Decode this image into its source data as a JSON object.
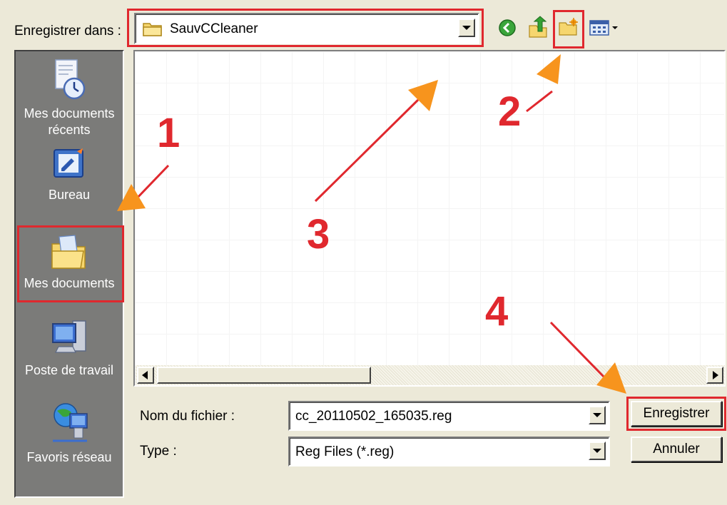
{
  "dialog": {
    "save_in_label": "Enregistrer dans :",
    "current_folder": "SauvCCleaner"
  },
  "toolbar": {
    "icons": [
      "back-icon",
      "up-folder-icon",
      "new-folder-icon",
      "view-menu-icon"
    ]
  },
  "places": [
    {
      "label": "Mes documents récents",
      "icon": "recent-documents-icon"
    },
    {
      "label": "Bureau",
      "icon": "desktop-icon"
    },
    {
      "label": "Mes documents",
      "icon": "my-documents-icon"
    },
    {
      "label": "Poste de travail",
      "icon": "my-computer-icon"
    },
    {
      "label": "Favoris réseau",
      "icon": "network-places-icon"
    }
  ],
  "fields": {
    "filename_label": "Nom du fichier :",
    "filename_value": "cc_20110502_165035.reg",
    "type_label": "Type :",
    "type_value": "Reg Files (*.reg)"
  },
  "buttons": {
    "save": "Enregistrer",
    "cancel": "Annuler"
  },
  "annotations": {
    "numbers": [
      "1",
      "2",
      "3",
      "4"
    ],
    "color": "#e0282e",
    "arrow_color": "#f7941d"
  }
}
